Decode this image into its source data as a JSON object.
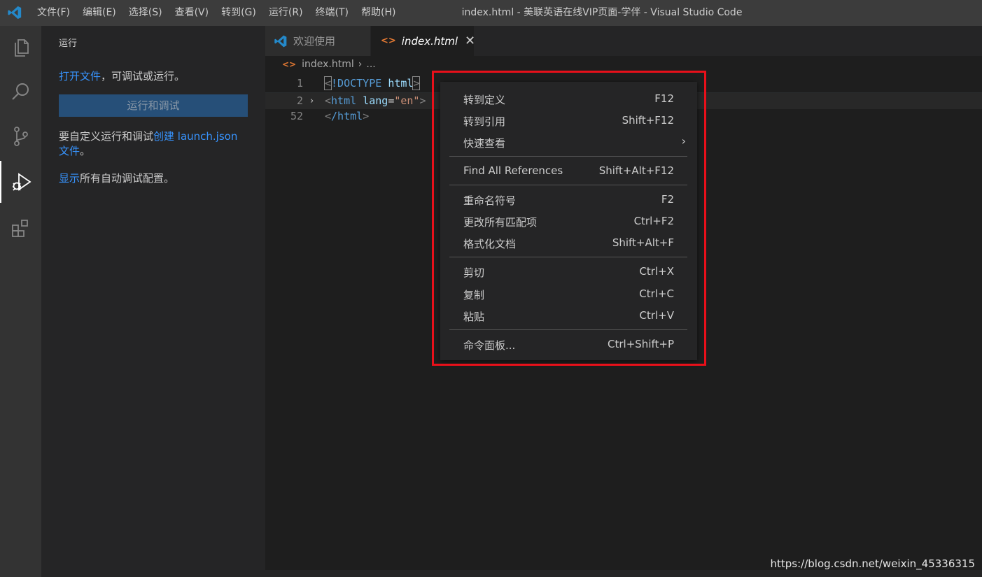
{
  "titlebar": {
    "menu": [
      "文件(F)",
      "编辑(E)",
      "选择(S)",
      "查看(V)",
      "转到(G)",
      "运行(R)",
      "终端(T)",
      "帮助(H)"
    ],
    "window_title": "index.html - 美联英语在线VIP页面-学伴 - Visual Studio Code",
    "logo_icon": "vscode-logo-icon"
  },
  "activitybar": {
    "items": [
      "explorer-icon",
      "search-icon",
      "source-control-icon",
      "run-debug-icon",
      "extensions-icon"
    ],
    "active": "run-debug-icon"
  },
  "sidebar": {
    "title": "运行",
    "open_file_link": "打开文件",
    "open_file_rest": "，可调试或运行。",
    "run_button": "运行和调试",
    "customize_prefix": "要自定义运行和调试",
    "customize_link": "创建 launch.json",
    "customize_link2": "文件",
    "customize_suffix": "。",
    "show_link": "显示",
    "show_rest": "所有自动调试配置。"
  },
  "tabs": [
    {
      "label": "欢迎使用",
      "active": false
    },
    {
      "label": "index.html",
      "active": true,
      "close": "✕"
    }
  ],
  "breadcrumb": {
    "file": "index.html",
    "sep": "›",
    "rest": "..."
  },
  "code": {
    "lines": [
      {
        "num": "1",
        "doctype": "!DOCTYPE",
        "html": "html"
      },
      {
        "num": "2",
        "tag": "html",
        "attr": "lang",
        "value": "\"en\"",
        "fold": "›"
      },
      {
        "num": "52",
        "close": "/html"
      }
    ]
  },
  "context_menu": {
    "items": [
      {
        "label": "转到定义",
        "key": "F12"
      },
      {
        "label": "转到引用",
        "key": "Shift+F12"
      },
      {
        "label": "快速查看",
        "key": "",
        "submenu": "›"
      },
      {
        "label": "Find All References",
        "key": "Shift+Alt+F12"
      },
      {
        "label": "重命名符号",
        "key": "F2"
      },
      {
        "label": "更改所有匹配项",
        "key": "Ctrl+F2"
      },
      {
        "label": "格式化文档",
        "key": "Shift+Alt+F"
      },
      {
        "label": "剪切",
        "key": "Ctrl+X"
      },
      {
        "label": "复制",
        "key": "Ctrl+C"
      },
      {
        "label": "粘贴",
        "key": "Ctrl+V"
      },
      {
        "label": "命令面板...",
        "key": "Ctrl+Shift+P"
      }
    ]
  },
  "watermark": "https://blog.csdn.net/weixin_45336315",
  "colors": {
    "highlight_box": "#e8101a",
    "link": "#3794ff",
    "accent": "#007acc"
  }
}
